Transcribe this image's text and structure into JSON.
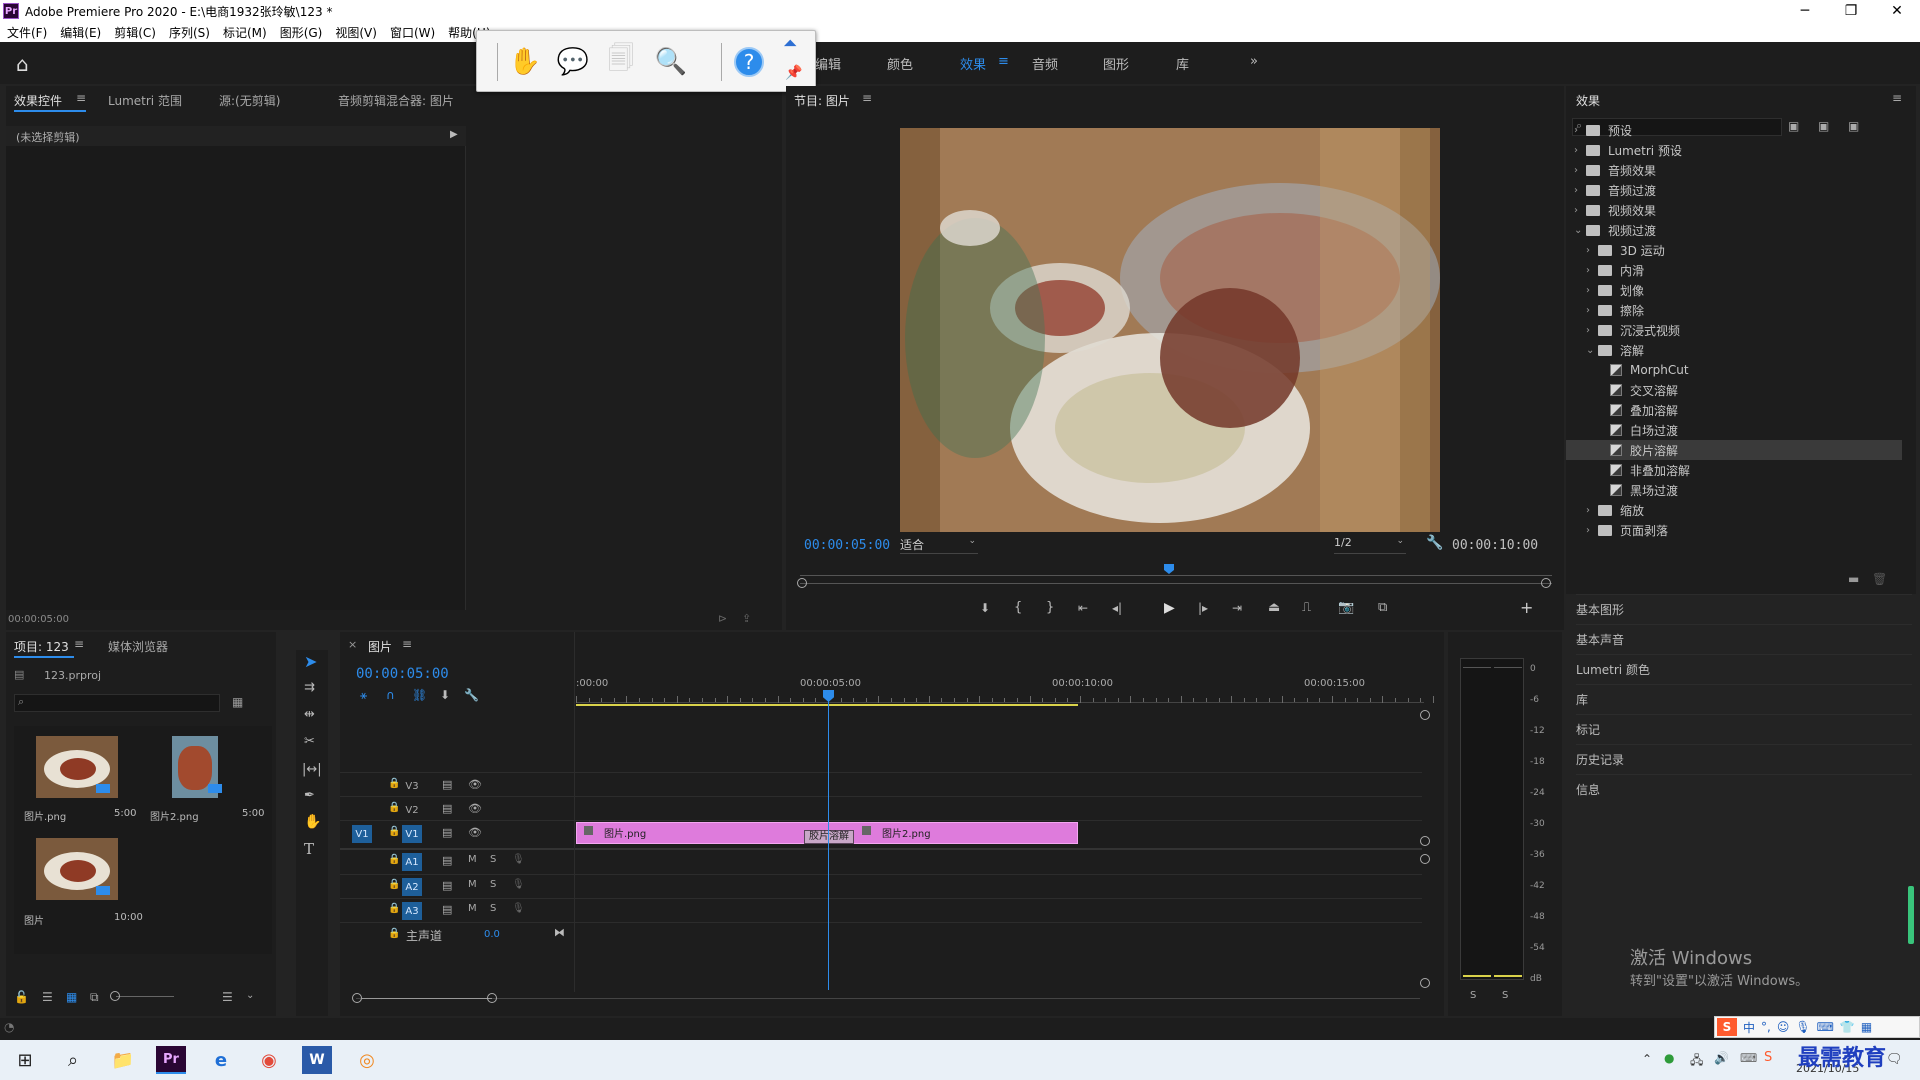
{
  "window": {
    "title": "Adobe Premiere Pro 2020 - E:\\电商1932张玲敏\\123 *",
    "app_icon": "Pr"
  },
  "menu": [
    "文件(F)",
    "编辑(E)",
    "剪辑(C)",
    "序列(S)",
    "标记(M)",
    "图形(G)",
    "视图(V)",
    "窗口(W)",
    "帮助(H)"
  ],
  "workspaces": {
    "tabs": [
      "编辑",
      "颜色",
      "效果",
      "音频",
      "图形",
      "库"
    ],
    "active": "效果",
    "more": "»"
  },
  "effect_controls": {
    "tabs": [
      "效果控件",
      "Lumetri 范围",
      "源:(无剪辑)",
      "音频剪辑混合器: 图片"
    ],
    "no_clip": "(未选择剪辑)",
    "timecode": "00:00:05:00"
  },
  "program": {
    "title": "节目: 图片",
    "timecode_left": "00:00:05:00",
    "zoom": "适合",
    "resolution": "1/2",
    "timecode_right": "00:00:10:00"
  },
  "effects_panel": {
    "title": "效果",
    "items": [
      {
        "label": "预设",
        "level": 0,
        "type": "folder",
        "state": "closed"
      },
      {
        "label": "Lumetri 预设",
        "level": 0,
        "type": "folder",
        "state": "closed"
      },
      {
        "label": "音频效果",
        "level": 0,
        "type": "folder",
        "state": "closed"
      },
      {
        "label": "音频过渡",
        "level": 0,
        "type": "folder",
        "state": "closed"
      },
      {
        "label": "视频效果",
        "level": 0,
        "type": "folder",
        "state": "closed"
      },
      {
        "label": "视频过渡",
        "level": 0,
        "type": "folder",
        "state": "open"
      },
      {
        "label": "3D 运动",
        "level": 1,
        "type": "folder",
        "state": "closed"
      },
      {
        "label": "内滑",
        "level": 1,
        "type": "folder",
        "state": "closed"
      },
      {
        "label": "划像",
        "level": 1,
        "type": "folder",
        "state": "closed"
      },
      {
        "label": "擦除",
        "level": 1,
        "type": "folder",
        "state": "closed"
      },
      {
        "label": "沉浸式视频",
        "level": 1,
        "type": "folder",
        "state": "closed"
      },
      {
        "label": "溶解",
        "level": 1,
        "type": "folder",
        "state": "open"
      },
      {
        "label": "MorphCut",
        "level": 2,
        "type": "fx"
      },
      {
        "label": "交叉溶解",
        "level": 2,
        "type": "fx"
      },
      {
        "label": "叠加溶解",
        "level": 2,
        "type": "fx"
      },
      {
        "label": "白场过渡",
        "level": 2,
        "type": "fx"
      },
      {
        "label": "胶片溶解",
        "level": 2,
        "type": "fx",
        "selected": true
      },
      {
        "label": "非叠加溶解",
        "level": 2,
        "type": "fx"
      },
      {
        "label": "黑场过渡",
        "level": 2,
        "type": "fx"
      },
      {
        "label": "缩放",
        "level": 1,
        "type": "folder",
        "state": "closed"
      },
      {
        "label": "页面剥落",
        "level": 1,
        "type": "folder",
        "state": "closed"
      }
    ]
  },
  "side_panels": [
    "基本图形",
    "基本声音",
    "Lumetri 颜色",
    "库",
    "标记",
    "历史记录",
    "信息"
  ],
  "project": {
    "tabs": [
      "项目: 123",
      "媒体浏览器"
    ],
    "file": "123.prproj",
    "items": [
      {
        "name": "图片.png",
        "duration": "5:00"
      },
      {
        "name": "图片2.png",
        "duration": "5:00"
      },
      {
        "name": "图片",
        "duration": "10:00"
      }
    ]
  },
  "timeline": {
    "tab": "图片",
    "timecode": "00:00:05:00",
    "ruler": [
      ":00:00",
      "00:00:05:00",
      "00:00:10:00",
      "00:00:15:00"
    ],
    "video_tracks": [
      "V3",
      "V2",
      "V1"
    ],
    "audio_tracks": [
      "A1",
      "A2",
      "A3"
    ],
    "source_patch": "V1",
    "master": "主声道",
    "master_value": "0.0",
    "clips": [
      "图片.png",
      "图片2.png"
    ],
    "transition": "胶片溶解",
    "mute": "M",
    "solo": "S"
  },
  "audio_meter": {
    "ticks": [
      "0",
      "-6",
      "-12",
      "-18",
      "-24",
      "-30",
      "-36",
      "-42",
      "-48",
      "-54",
      "dB"
    ],
    "solo": [
      "S",
      "S"
    ]
  },
  "watermark": {
    "line1": "激活 Windows",
    "line2": "转到\"设置\"以激活 Windows。"
  },
  "taskbar": {
    "date": "2021/10/15",
    "brand": "最需教育",
    "ime": "中",
    "apps": [
      "start-icon",
      "search-icon",
      "explorer-icon",
      "premiere-icon",
      "edge-icon",
      "chrome-icon",
      "word-icon",
      "app-icon"
    ]
  }
}
